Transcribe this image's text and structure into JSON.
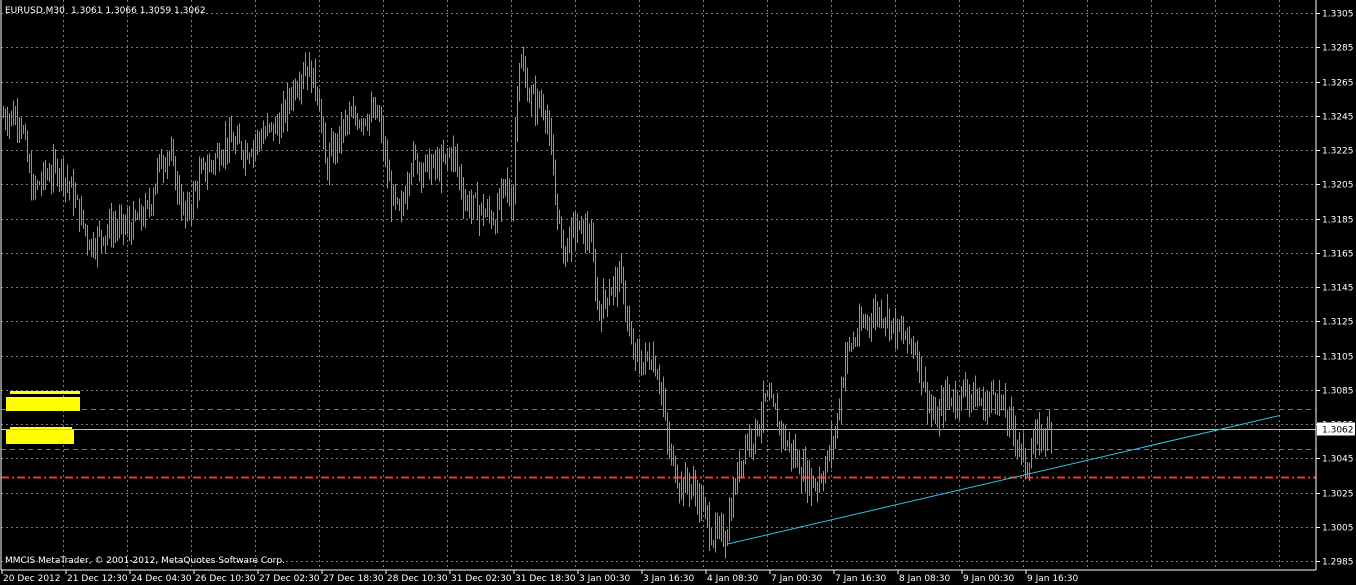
{
  "chart_header": {
    "symbol": "EURUSD,M30",
    "ohlc": "1.3061 1.3066 1.3059 1.3062"
  },
  "copyright": "MMCIS MetaTrader, © 2001-2012, MetaQuotes Software Corp.",
  "current_price_label": "1.3062",
  "colors": {
    "background": "#000000",
    "bars": "#4fc24f",
    "grid": "#7a7a7a",
    "axis_text": "#ffffff",
    "trendline": "#29c6e6",
    "level_lines": "#3a9e3a",
    "support_line": "#e53a2f",
    "yellow_marks": "#ffff00",
    "current_price_line": "#bfbfbf"
  },
  "chart_data": {
    "type": "ohlc",
    "title": "",
    "grid": true,
    "y_ticks": [
      "1.3305",
      "1.3285",
      "1.3265",
      "1.3245",
      "1.3225",
      "1.3205",
      "1.3185",
      "1.3165",
      "1.3145",
      "1.3125",
      "1.3105",
      "1.3085",
      "1.3065",
      "1.3045",
      "1.3025",
      "1.3005",
      "1.2985"
    ],
    "ylim": [
      1.2978,
      1.331
    ],
    "x_labels": [
      "20 Dec 2012",
      "21 Dec 12:30",
      "24 Dec 04:30",
      "26 Dec 10:30",
      "27 Dec 02:30",
      "27 Dec 18:30",
      "28 Dec 10:30",
      "31 Dec 02:30",
      "31 Dec 18:30",
      "3 Jan 00:30",
      "3 Jan 16:30",
      "4 Jan 08:30",
      "7 Jan 00:30",
      "7 Jan 16:30",
      "8 Jan 08:30",
      "9 Jan 00:30",
      "9 Jan 16:30"
    ],
    "price_anchors": [
      [
        0,
        1.3245
      ],
      [
        20,
        1.3245
      ],
      [
        32,
        1.32
      ],
      [
        45,
        1.321
      ],
      [
        60,
        1.3215
      ],
      [
        72,
        1.32
      ],
      [
        90,
        1.317
      ],
      [
        110,
        1.318
      ],
      [
        130,
        1.318
      ],
      [
        148,
        1.319
      ],
      [
        158,
        1.3215
      ],
      [
        168,
        1.3225
      ],
      [
        185,
        1.3185
      ],
      [
        200,
        1.321
      ],
      [
        215,
        1.322
      ],
      [
        225,
        1.323
      ],
      [
        245,
        1.3225
      ],
      [
        265,
        1.3235
      ],
      [
        280,
        1.324
      ],
      [
        292,
        1.326
      ],
      [
        305,
        1.3275
      ],
      [
        318,
        1.326
      ],
      [
        325,
        1.3215
      ],
      [
        345,
        1.324
      ],
      [
        360,
        1.3245
      ],
      [
        378,
        1.3245
      ],
      [
        390,
        1.32
      ],
      [
        400,
        1.3185
      ],
      [
        410,
        1.322
      ],
      [
        425,
        1.3215
      ],
      [
        440,
        1.3215
      ],
      [
        452,
        1.3225
      ],
      [
        465,
        1.3195
      ],
      [
        480,
        1.319
      ],
      [
        495,
        1.3185
      ],
      [
        505,
        1.3205
      ],
      [
        512,
        1.319
      ],
      [
        518,
        1.328
      ],
      [
        530,
        1.3255
      ],
      [
        545,
        1.325
      ],
      [
        555,
        1.32
      ],
      [
        562,
        1.3165
      ],
      [
        575,
        1.318
      ],
      [
        590,
        1.3175
      ],
      [
        598,
        1.313
      ],
      [
        610,
        1.3145
      ],
      [
        622,
        1.315
      ],
      [
        630,
        1.311
      ],
      [
        640,
        1.31
      ],
      [
        652,
        1.3105
      ],
      [
        660,
        1.309
      ],
      [
        668,
        1.305
      ],
      [
        680,
        1.303
      ],
      [
        690,
        1.303
      ],
      [
        700,
        1.302
      ],
      [
        712,
        1.3
      ],
      [
        725,
        1.3
      ],
      [
        735,
        1.303
      ],
      [
        745,
        1.3055
      ],
      [
        755,
        1.306
      ],
      [
        765,
        1.308
      ],
      [
        775,
        1.307
      ],
      [
        785,
        1.3055
      ],
      [
        795,
        1.3045
      ],
      [
        805,
        1.3035
      ],
      [
        815,
        1.303
      ],
      [
        825,
        1.304
      ],
      [
        835,
        1.306
      ],
      [
        845,
        1.3105
      ],
      [
        855,
        1.3115
      ],
      [
        865,
        1.3125
      ],
      [
        875,
        1.313
      ],
      [
        885,
        1.313
      ],
      [
        895,
        1.312
      ],
      [
        905,
        1.3115
      ],
      [
        915,
        1.311
      ],
      [
        925,
        1.3085
      ],
      [
        935,
        1.3065
      ],
      [
        945,
        1.308
      ],
      [
        955,
        1.308
      ],
      [
        965,
        1.3085
      ],
      [
        975,
        1.308
      ],
      [
        985,
        1.3075
      ],
      [
        995,
        1.3085
      ],
      [
        1005,
        1.307
      ],
      [
        1015,
        1.306
      ],
      [
        1025,
        1.304
      ],
      [
        1035,
        1.3055
      ],
      [
        1045,
        1.306
      ],
      [
        1052,
        1.3062
      ]
    ],
    "trendline": {
      "from": [
        728,
        1.2995
      ],
      "to": [
        1280,
        1.307
      ]
    },
    "level_lines": [
      {
        "name": "upper-level",
        "price": 1.30735,
        "style": "dashed"
      },
      {
        "name": "lower-level",
        "price": 1.30505,
        "style": "dashed"
      },
      {
        "name": "support-line",
        "price": 1.3034,
        "style": "dash-dot"
      }
    ],
    "current_price": 1.3062
  }
}
